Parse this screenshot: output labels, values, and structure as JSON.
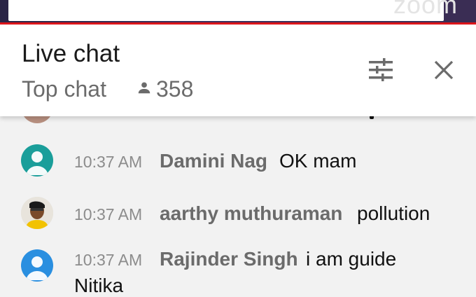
{
  "header": {
    "title": "Live chat",
    "mode": "Top chat",
    "viewer_count": "358"
  },
  "icons": {
    "viewers": "person-icon",
    "filter": "tune-icon",
    "close": "close-icon"
  },
  "colors": {
    "accent_red": "#e0161b",
    "author_gray": "#6b6b6b",
    "timestamp_gray": "#8c8c8c",
    "avatar_teal": "#1a9e9a",
    "avatar_blue": "#2a8fe0"
  },
  "messages": [
    {
      "time": "10:37 AM",
      "author": "Damini Nag",
      "text": "OK mam"
    },
    {
      "time": "10:37 AM",
      "author": "aarthy muthuraman",
      "text": "pollution"
    },
    {
      "time": "10:37 AM",
      "author": "Rajinder Singh",
      "text": "i am guide",
      "text_cont": "Nitika"
    }
  ]
}
